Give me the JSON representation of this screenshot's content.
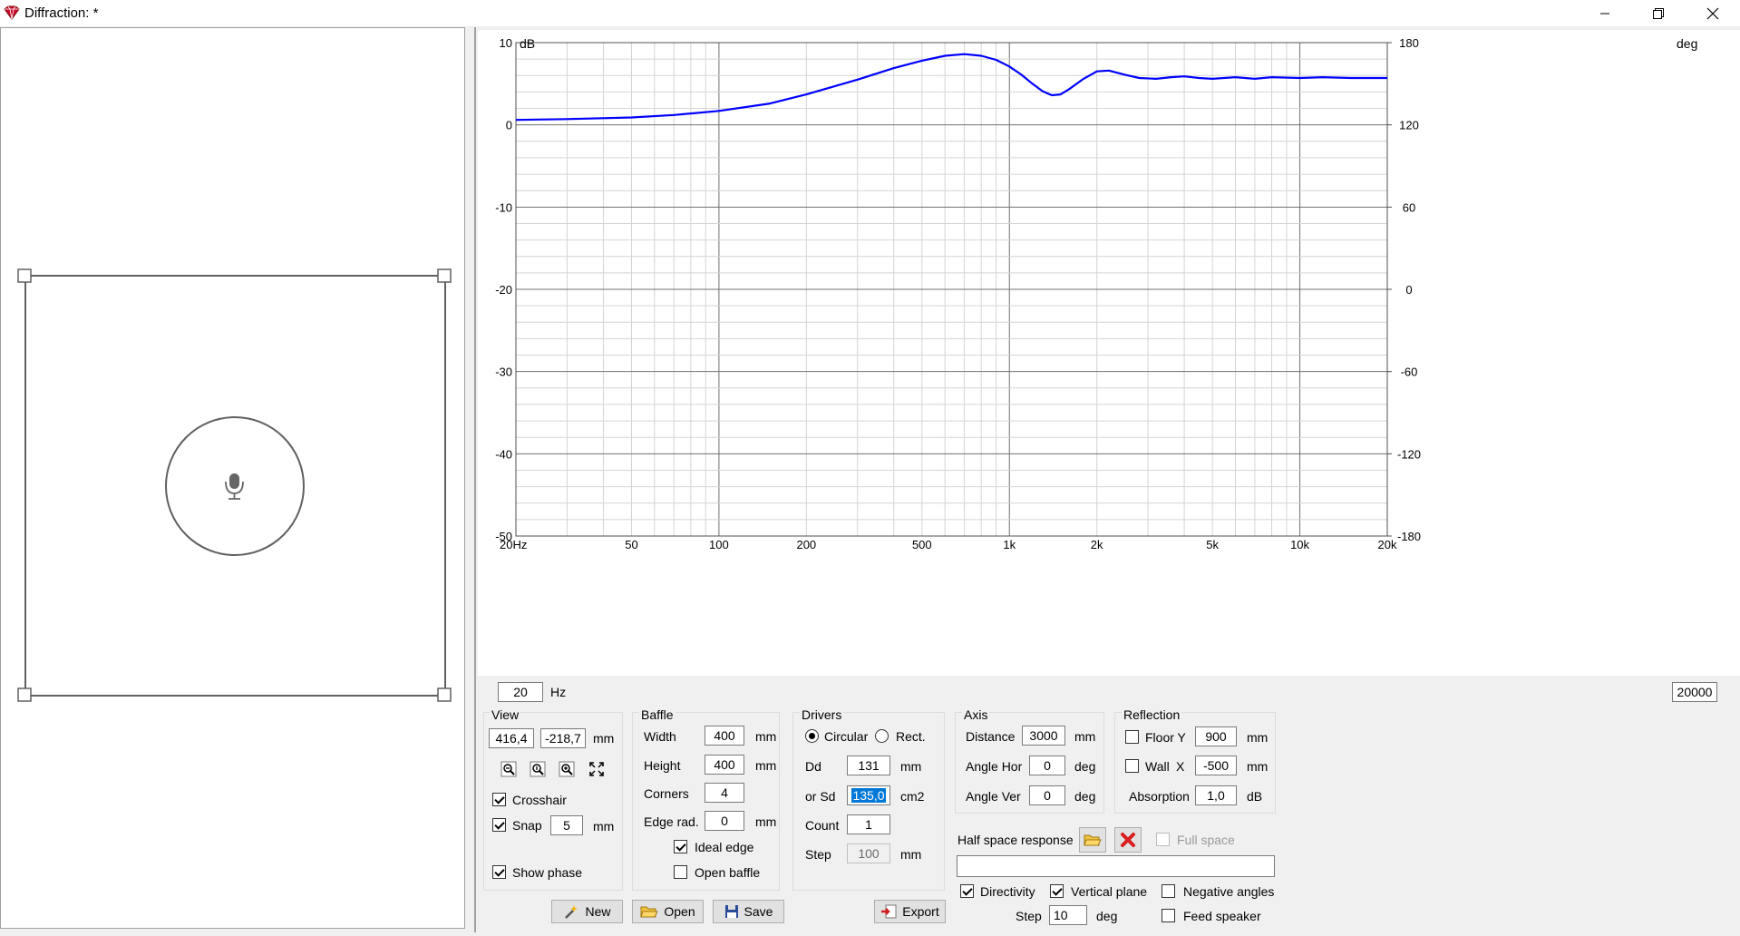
{
  "window": {
    "title": "Diffraction: *",
    "minimize_icon": "minimize-icon",
    "restore_icon": "restore-icon",
    "close_icon": "close-icon"
  },
  "baffle_view": {
    "mic_icon": "microphone-icon"
  },
  "chart_data": {
    "type": "line",
    "title": "",
    "xlabel": "",
    "ylabel_left": "dB",
    "ylabel_right": "deg",
    "x_scale": "log",
    "xlim": [
      20,
      20000
    ],
    "ylim_left": [
      -50,
      10
    ],
    "ylim_right": [
      -180,
      180
    ],
    "x_ticks": [
      "20Hz",
      "50",
      "100",
      "200",
      "500",
      "1k",
      "2k",
      "5k",
      "10k",
      "20k"
    ],
    "y_ticks_left": [
      "10",
      "0",
      "-10",
      "-20",
      "-30",
      "-40",
      "-50"
    ],
    "y_ticks_right": [
      "180",
      "120",
      "60",
      "0",
      "-60",
      "-120",
      "-180"
    ],
    "grid": true,
    "series": [
      {
        "color": "#0000ff",
        "points": [
          [
            20,
            0.6
          ],
          [
            30,
            0.7
          ],
          [
            50,
            0.9
          ],
          [
            70,
            1.2
          ],
          [
            100,
            1.7
          ],
          [
            150,
            2.6
          ],
          [
            200,
            3.7
          ],
          [
            300,
            5.5
          ],
          [
            400,
            6.9
          ],
          [
            500,
            7.8
          ],
          [
            600,
            8.4
          ],
          [
            700,
            8.6
          ],
          [
            800,
            8.4
          ],
          [
            900,
            7.9
          ],
          [
            1000,
            7.1
          ],
          [
            1100,
            6.1
          ],
          [
            1200,
            5.0
          ],
          [
            1300,
            4.1
          ],
          [
            1400,
            3.6
          ],
          [
            1500,
            3.7
          ],
          [
            1600,
            4.3
          ],
          [
            1800,
            5.6
          ],
          [
            2000,
            6.5
          ],
          [
            2200,
            6.6
          ],
          [
            2500,
            6.1
          ],
          [
            2800,
            5.7
          ],
          [
            3200,
            5.6
          ],
          [
            3600,
            5.8
          ],
          [
            4000,
            5.9
          ],
          [
            4500,
            5.7
          ],
          [
            5000,
            5.6
          ],
          [
            6000,
            5.8
          ],
          [
            7000,
            5.6
          ],
          [
            8000,
            5.8
          ],
          [
            10000,
            5.7
          ],
          [
            12000,
            5.8
          ],
          [
            15000,
            5.7
          ],
          [
            20000,
            5.7
          ]
        ]
      }
    ]
  },
  "freq_min": {
    "value": "20",
    "unit": "Hz"
  },
  "freq_max": {
    "value": "20000"
  },
  "view": {
    "title": "View",
    "x_value": "416,4",
    "y_value": "-218,7",
    "unit": "mm",
    "zoom_out_icon": "zoom-out-icon",
    "zoom_fit_icon": "zoom-fit-icon",
    "zoom_in_icon": "zoom-in-icon",
    "full_extent_icon": "full-extent-icon",
    "crosshair_label": "Crosshair",
    "crosshair_checked": true,
    "snap_label": "Snap",
    "snap_checked": true,
    "snap_value": "5",
    "snap_unit": "mm",
    "show_phase_label": "Show phase",
    "show_phase_checked": true
  },
  "baffle": {
    "title": "Baffle",
    "width_label": "Width",
    "width_value": "400",
    "width_unit": "mm",
    "height_label": "Height",
    "height_value": "400",
    "height_unit": "mm",
    "corners_label": "Corners",
    "corners_value": "4",
    "edge_rad_label": "Edge rad.",
    "edge_rad_value": "0",
    "edge_rad_unit": "mm",
    "ideal_edge_label": "Ideal edge",
    "ideal_edge_checked": true,
    "open_baffle_label": "Open baffle",
    "open_baffle_checked": false
  },
  "drivers": {
    "title": "Drivers",
    "circular_label": "Circular",
    "rect_label": "Rect.",
    "shape_selected": "circular",
    "dd_label": "Dd",
    "dd_value": "131",
    "dd_unit": "mm",
    "sd_label": "or Sd",
    "sd_value": "135,0",
    "sd_unit": "cm2",
    "count_label": "Count",
    "count_value": "1",
    "step_label": "Step",
    "step_value": "100",
    "step_unit": "mm"
  },
  "axis": {
    "title": "Axis",
    "distance_label": "Distance",
    "distance_value": "3000",
    "distance_unit": "mm",
    "angle_hor_label": "Angle Hor",
    "angle_hor_value": "0",
    "angle_hor_unit": "deg",
    "angle_ver_label": "Angle Ver",
    "angle_ver_value": "0",
    "angle_ver_unit": "deg"
  },
  "reflection": {
    "title": "Reflection",
    "floor_label": "Floor Y",
    "floor_checked": false,
    "floor_value": "900",
    "floor_unit": "mm",
    "wall_label": "Wall",
    "wall_axis": "X",
    "wall_checked": false,
    "wall_value": "-500",
    "wall_unit": "mm",
    "absorption_label": "Absorption",
    "absorption_value": "1,0",
    "absorption_unit": "dB"
  },
  "half_space": {
    "label": "Half space response",
    "open_icon": "folder-open-icon",
    "delete_icon": "delete-icon",
    "full_space_label": "Full space",
    "full_space_checked": false,
    "file_value": ""
  },
  "directivity": {
    "directivity_label": "Directivity",
    "directivity_checked": true,
    "vertical_label": "Vertical plane",
    "vertical_checked": true,
    "negative_label": "Negative angles",
    "negative_checked": false,
    "step_label": "Step",
    "step_value": "10",
    "step_unit": "deg",
    "feed_label": "Feed speaker",
    "feed_checked": false
  },
  "toolbar": {
    "new_label": "New",
    "new_icon": "magic-wand-icon",
    "open_label": "Open",
    "open_icon": "folder-icon",
    "save_label": "Save",
    "save_icon": "floppy-icon",
    "export_label": "Export",
    "export_icon": "export-icon"
  }
}
